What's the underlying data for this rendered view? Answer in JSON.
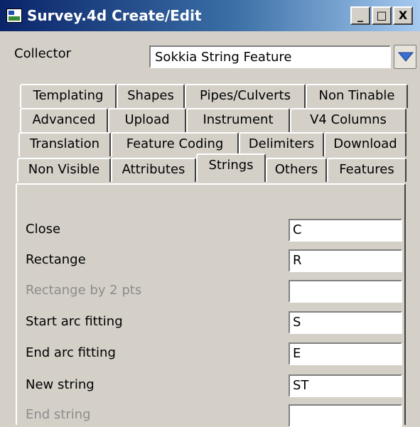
{
  "window": {
    "title": "Survey.4d Create/Edit",
    "buttons": {
      "minimize": "_",
      "maximize": "□",
      "close": "X"
    }
  },
  "collector": {
    "label": "Collector",
    "value": "Sokkia String Feature"
  },
  "tabs": {
    "row1": [
      "Templating",
      "Shapes",
      "Pipes/Culverts",
      "Non Tinable"
    ],
    "row2": [
      "Advanced",
      "Upload",
      "Instrument",
      "V4 Columns"
    ],
    "row3": [
      "Translation",
      "Feature Coding",
      "Delimiters",
      "Download"
    ],
    "row4": [
      "Non Visible",
      "Attributes",
      "Strings",
      "Others",
      "Features"
    ],
    "active": "Strings"
  },
  "fields": [
    {
      "label": "Close",
      "value": "C",
      "enabled": true
    },
    {
      "label": "Rectange",
      "value": "R",
      "enabled": true
    },
    {
      "label": "Rectange by 2 pts",
      "value": "",
      "enabled": false
    },
    {
      "label": "Start arc fitting",
      "value": "S",
      "enabled": true
    },
    {
      "label": "End arc fitting",
      "value": "E",
      "enabled": true
    },
    {
      "label": "New string",
      "value": "ST",
      "enabled": true
    },
    {
      "label": "End string",
      "value": "",
      "enabled": false
    }
  ],
  "colors": {
    "title_gradient_start": "#0a246a",
    "title_gradient_end": "#a6caf0",
    "face": "#d4d0c8",
    "disabled_text": "#8c8c8c",
    "dropdown_arrow": "#3c6fd0"
  }
}
